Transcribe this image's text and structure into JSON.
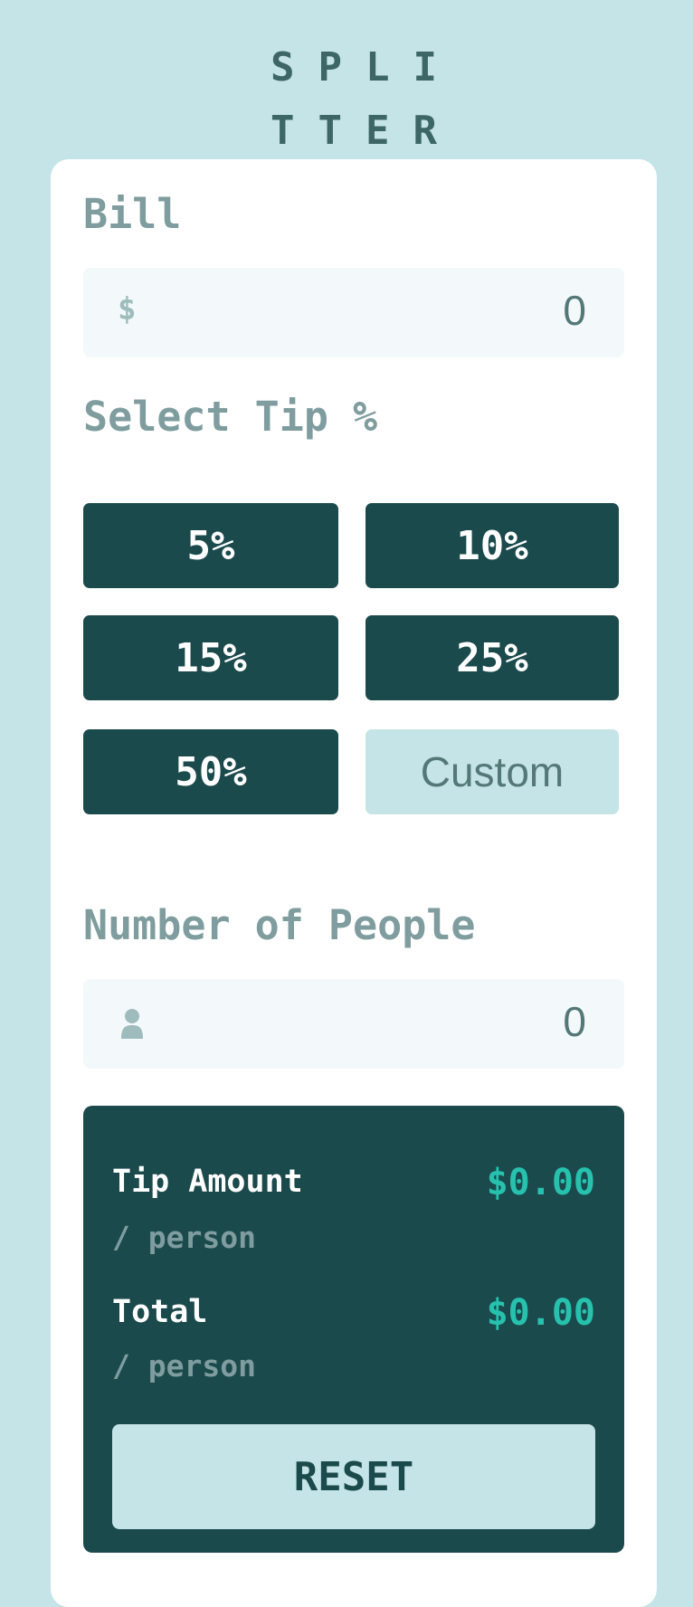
{
  "logo": {
    "line1": "SPLI",
    "line2": "TTER"
  },
  "bill": {
    "label": "Bill",
    "currency_icon": "$",
    "value": "0"
  },
  "tip": {
    "label": "Select Tip %",
    "options": [
      "5%",
      "10%",
      "15%",
      "25%",
      "50%"
    ],
    "custom_label": "Custom"
  },
  "people": {
    "label": "Number of People",
    "icon": "person-icon",
    "value": "0"
  },
  "results": {
    "tip_amount_label": "Tip Amount",
    "tip_amount_sub": "/ person",
    "tip_amount_value": "$0.00",
    "total_label": "Total",
    "total_sub": "/ person",
    "total_value": "$0.00",
    "reset_label": "RESET"
  },
  "colors": {
    "background": "#c5e4e7",
    "card": "#ffffff",
    "dark_cyan": "#1b4a4d",
    "accent": "#26c2ae",
    "label_grey": "#7f9d9f",
    "input_bg": "#f3f9fa"
  }
}
